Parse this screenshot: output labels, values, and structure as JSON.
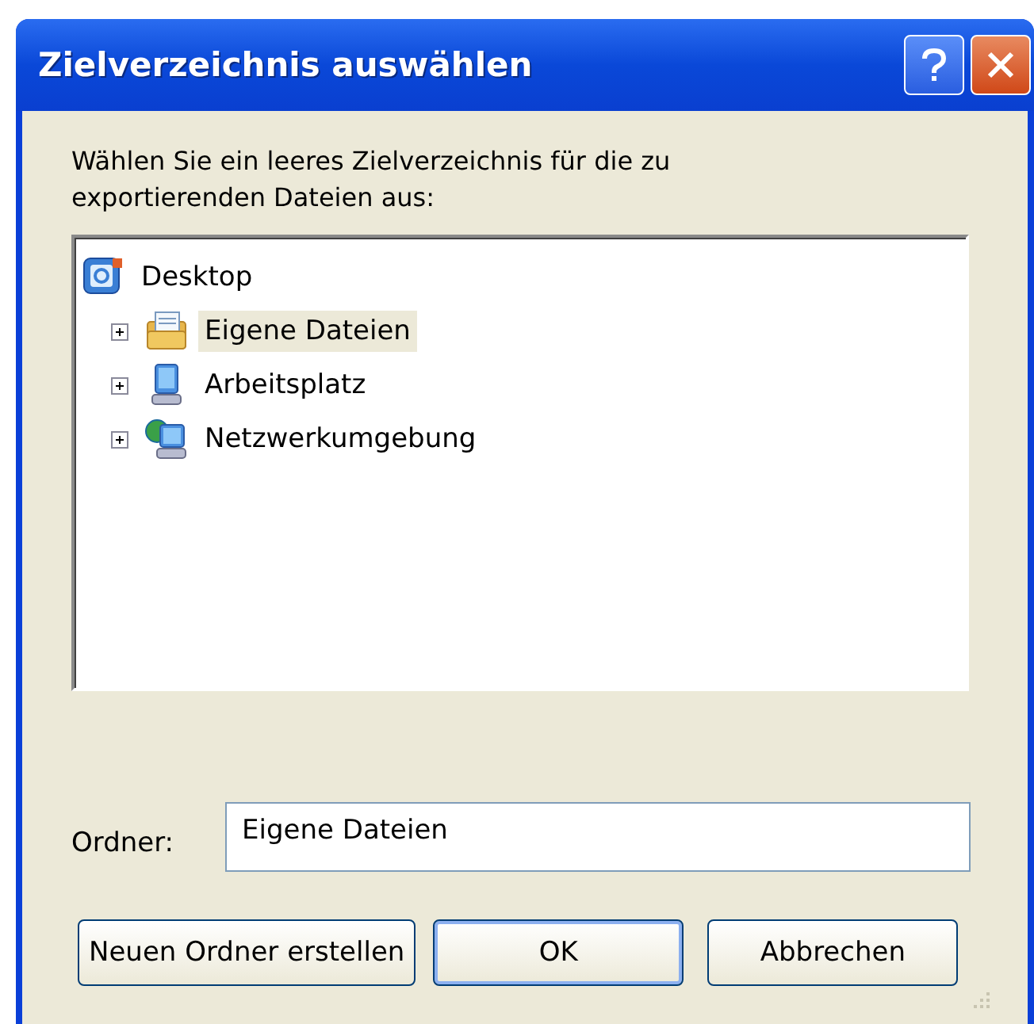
{
  "window": {
    "title": "Zielverzeichnis auswählen"
  },
  "instruction": "Wählen Sie ein leeres Zielverzeichnis für die zu exportierenden Dateien aus:",
  "tree": [
    {
      "label": "Desktop",
      "kind": "desktop",
      "selected": false,
      "children": [
        {
          "label": "Eigene Dateien",
          "kind": "documents",
          "selected": true,
          "expanded": false
        },
        {
          "label": "Arbeitsplatz",
          "kind": "computer",
          "selected": false,
          "expanded": false
        },
        {
          "label": "Netzwerkumgebung",
          "kind": "network",
          "selected": false,
          "expanded": false
        }
      ]
    }
  ],
  "folder": {
    "label": "Ordner:",
    "value": "Eigene Dateien"
  },
  "buttons": [
    {
      "label": "Neuen Ordner erstellen",
      "default": false
    },
    {
      "label": "OK",
      "default": true
    },
    {
      "label": "Abbrechen",
      "default": false
    }
  ]
}
